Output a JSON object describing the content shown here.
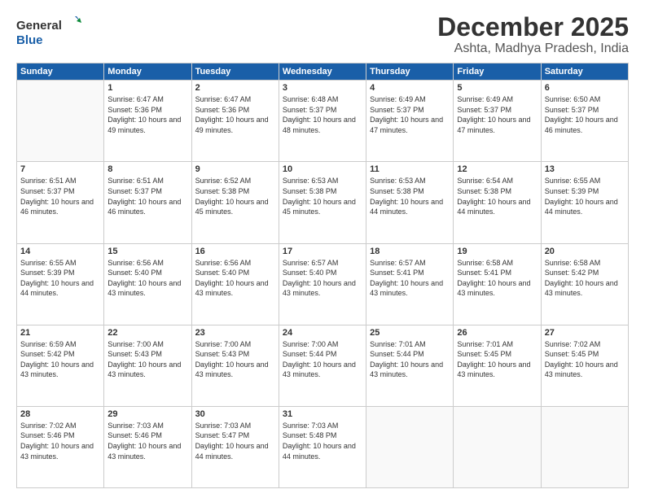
{
  "header": {
    "logo_line1": "General",
    "logo_line2": "Blue",
    "title": "December 2025",
    "subtitle": "Ashta, Madhya Pradesh, India"
  },
  "days_of_week": [
    "Sunday",
    "Monday",
    "Tuesday",
    "Wednesday",
    "Thursday",
    "Friday",
    "Saturday"
  ],
  "weeks": [
    [
      {
        "day": "",
        "empty": true
      },
      {
        "day": "1",
        "sunrise": "6:47 AM",
        "sunset": "5:36 PM",
        "daylight": "10 hours and 49 minutes."
      },
      {
        "day": "2",
        "sunrise": "6:47 AM",
        "sunset": "5:36 PM",
        "daylight": "10 hours and 49 minutes."
      },
      {
        "day": "3",
        "sunrise": "6:48 AM",
        "sunset": "5:37 PM",
        "daylight": "10 hours and 48 minutes."
      },
      {
        "day": "4",
        "sunrise": "6:49 AM",
        "sunset": "5:37 PM",
        "daylight": "10 hours and 47 minutes."
      },
      {
        "day": "5",
        "sunrise": "6:49 AM",
        "sunset": "5:37 PM",
        "daylight": "10 hours and 47 minutes."
      },
      {
        "day": "6",
        "sunrise": "6:50 AM",
        "sunset": "5:37 PM",
        "daylight": "10 hours and 46 minutes."
      }
    ],
    [
      {
        "day": "7",
        "sunrise": "6:51 AM",
        "sunset": "5:37 PM",
        "daylight": "10 hours and 46 minutes."
      },
      {
        "day": "8",
        "sunrise": "6:51 AM",
        "sunset": "5:37 PM",
        "daylight": "10 hours and 46 minutes."
      },
      {
        "day": "9",
        "sunrise": "6:52 AM",
        "sunset": "5:38 PM",
        "daylight": "10 hours and 45 minutes."
      },
      {
        "day": "10",
        "sunrise": "6:53 AM",
        "sunset": "5:38 PM",
        "daylight": "10 hours and 45 minutes."
      },
      {
        "day": "11",
        "sunrise": "6:53 AM",
        "sunset": "5:38 PM",
        "daylight": "10 hours and 44 minutes."
      },
      {
        "day": "12",
        "sunrise": "6:54 AM",
        "sunset": "5:38 PM",
        "daylight": "10 hours and 44 minutes."
      },
      {
        "day": "13",
        "sunrise": "6:55 AM",
        "sunset": "5:39 PM",
        "daylight": "10 hours and 44 minutes."
      }
    ],
    [
      {
        "day": "14",
        "sunrise": "6:55 AM",
        "sunset": "5:39 PM",
        "daylight": "10 hours and 44 minutes."
      },
      {
        "day": "15",
        "sunrise": "6:56 AM",
        "sunset": "5:40 PM",
        "daylight": "10 hours and 43 minutes."
      },
      {
        "day": "16",
        "sunrise": "6:56 AM",
        "sunset": "5:40 PM",
        "daylight": "10 hours and 43 minutes."
      },
      {
        "day": "17",
        "sunrise": "6:57 AM",
        "sunset": "5:40 PM",
        "daylight": "10 hours and 43 minutes."
      },
      {
        "day": "18",
        "sunrise": "6:57 AM",
        "sunset": "5:41 PM",
        "daylight": "10 hours and 43 minutes."
      },
      {
        "day": "19",
        "sunrise": "6:58 AM",
        "sunset": "5:41 PM",
        "daylight": "10 hours and 43 minutes."
      },
      {
        "day": "20",
        "sunrise": "6:58 AM",
        "sunset": "5:42 PM",
        "daylight": "10 hours and 43 minutes."
      }
    ],
    [
      {
        "day": "21",
        "sunrise": "6:59 AM",
        "sunset": "5:42 PM",
        "daylight": "10 hours and 43 minutes."
      },
      {
        "day": "22",
        "sunrise": "7:00 AM",
        "sunset": "5:43 PM",
        "daylight": "10 hours and 43 minutes."
      },
      {
        "day": "23",
        "sunrise": "7:00 AM",
        "sunset": "5:43 PM",
        "daylight": "10 hours and 43 minutes."
      },
      {
        "day": "24",
        "sunrise": "7:00 AM",
        "sunset": "5:44 PM",
        "daylight": "10 hours and 43 minutes."
      },
      {
        "day": "25",
        "sunrise": "7:01 AM",
        "sunset": "5:44 PM",
        "daylight": "10 hours and 43 minutes."
      },
      {
        "day": "26",
        "sunrise": "7:01 AM",
        "sunset": "5:45 PM",
        "daylight": "10 hours and 43 minutes."
      },
      {
        "day": "27",
        "sunrise": "7:02 AM",
        "sunset": "5:45 PM",
        "daylight": "10 hours and 43 minutes."
      }
    ],
    [
      {
        "day": "28",
        "sunrise": "7:02 AM",
        "sunset": "5:46 PM",
        "daylight": "10 hours and 43 minutes."
      },
      {
        "day": "29",
        "sunrise": "7:03 AM",
        "sunset": "5:46 PM",
        "daylight": "10 hours and 43 minutes."
      },
      {
        "day": "30",
        "sunrise": "7:03 AM",
        "sunset": "5:47 PM",
        "daylight": "10 hours and 44 minutes."
      },
      {
        "day": "31",
        "sunrise": "7:03 AM",
        "sunset": "5:48 PM",
        "daylight": "10 hours and 44 minutes."
      },
      {
        "day": "",
        "empty": true
      },
      {
        "day": "",
        "empty": true
      },
      {
        "day": "",
        "empty": true
      }
    ]
  ]
}
